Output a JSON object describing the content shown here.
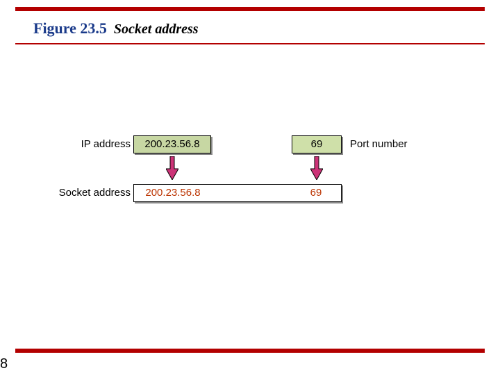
{
  "figure": {
    "number": "Figure 23.5",
    "title": "Socket address"
  },
  "labels": {
    "ip": "IP address",
    "port": "Port number",
    "socket": "Socket address"
  },
  "values": {
    "ip": "200.23.56.8",
    "port": "69",
    "socket_ip": "200.23.56.8",
    "socket_port": "69"
  },
  "colors": {
    "rule": "#b30000",
    "box_fill": "#c7d7a3",
    "arrow_fill": "#cc3377",
    "arrow_stroke": "#000",
    "socket_text": "#bb3300",
    "fig_num": "#1a3a8a"
  },
  "page_number": "8"
}
